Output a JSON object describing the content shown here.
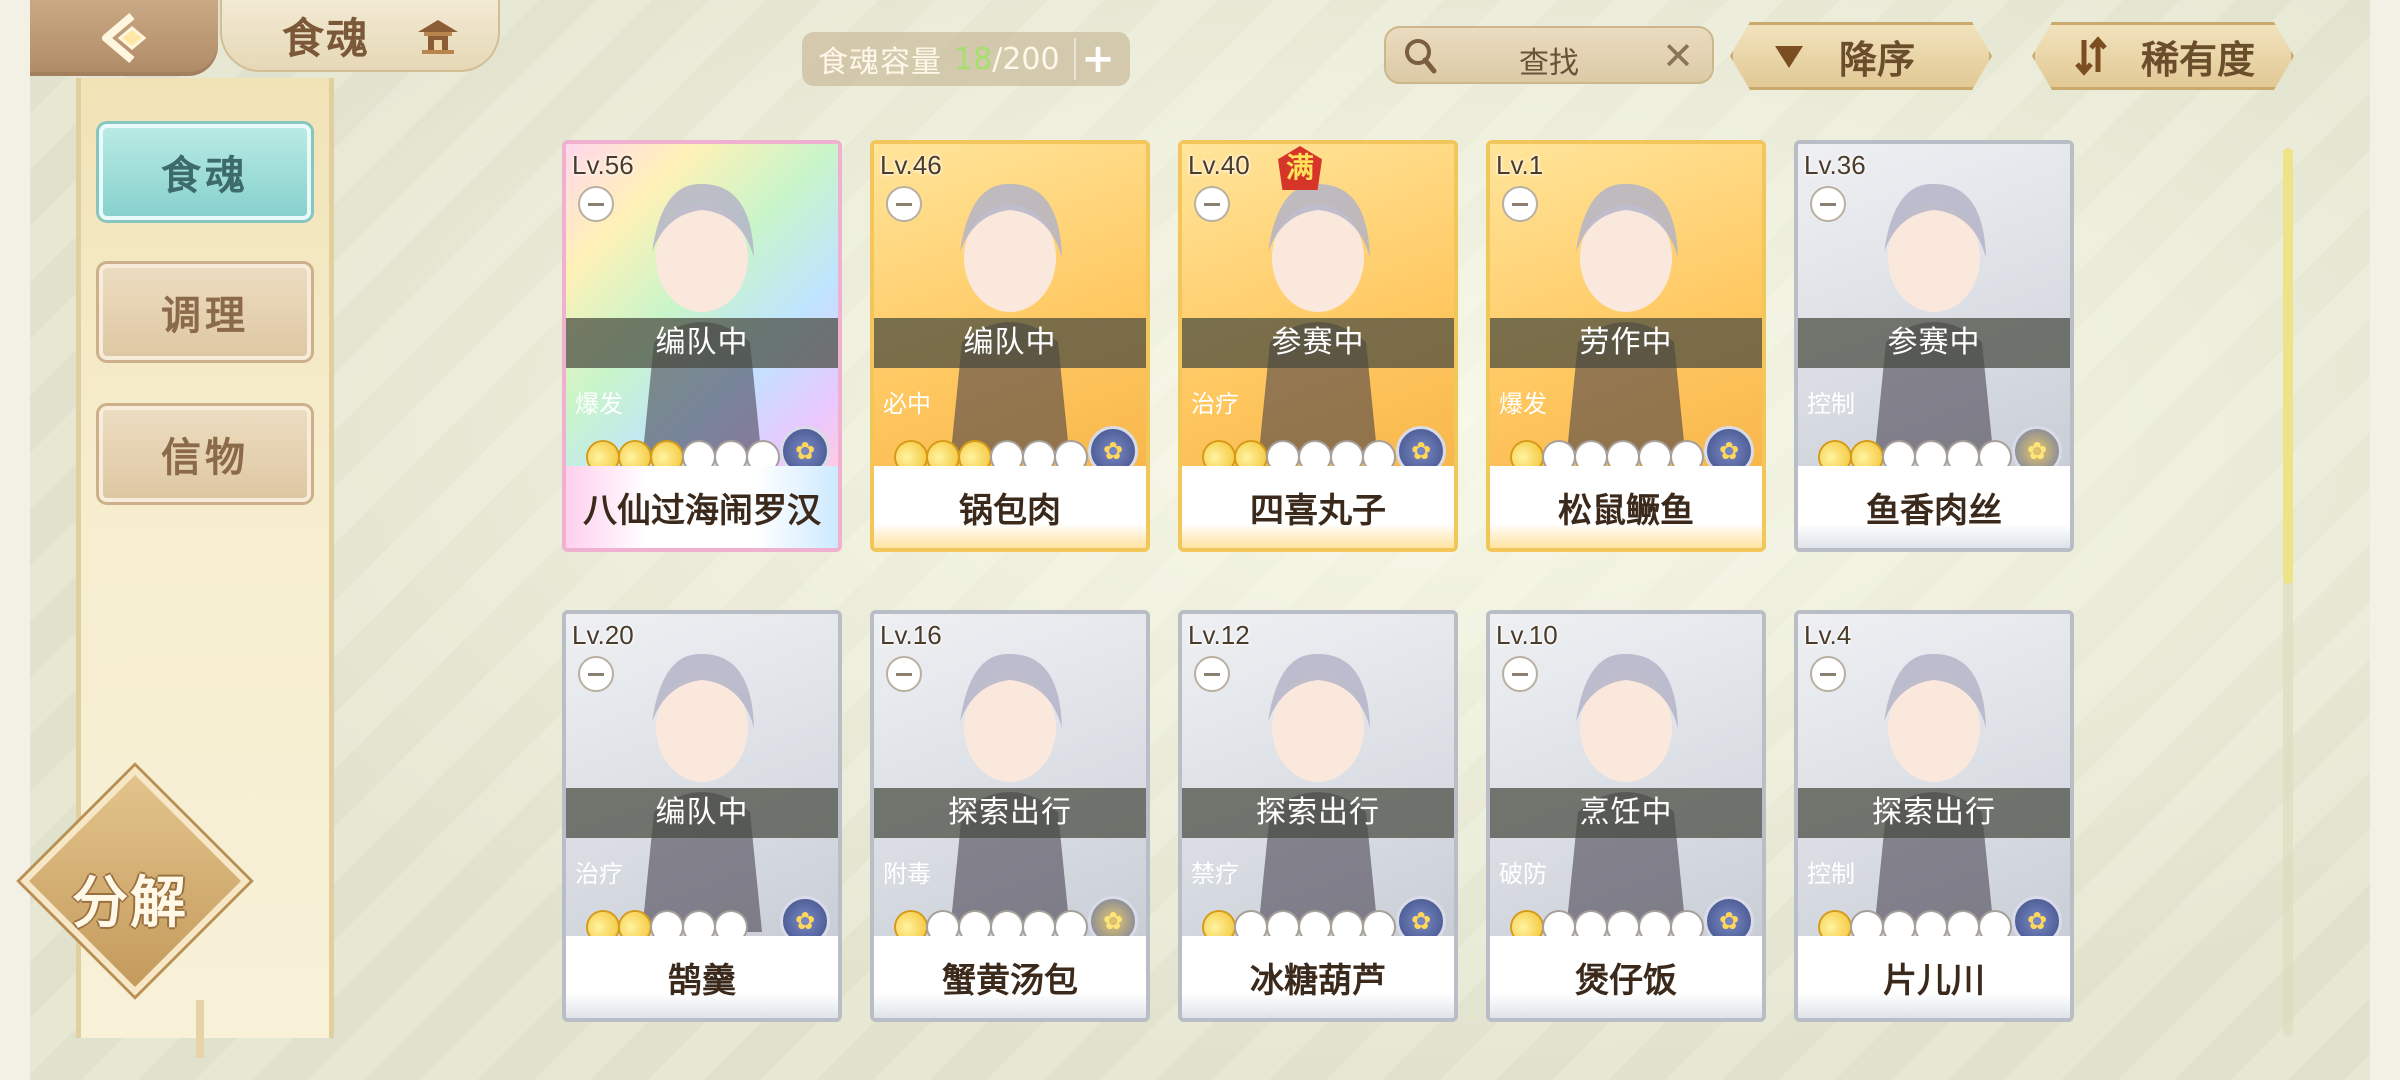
{
  "header": {
    "title": "食魂",
    "capacity_label": "食魂容量",
    "capacity_count": "18",
    "capacity_max": "/200",
    "capacity_add": "+",
    "search_text": "查找",
    "search_clear": "✕",
    "sort_order": "降序",
    "sort_by": "稀有度"
  },
  "sidebar": {
    "items": [
      {
        "label": "食魂",
        "active": true
      },
      {
        "label": "调理",
        "active": false
      },
      {
        "label": "信物",
        "active": false
      }
    ],
    "decompose": "分解"
  },
  "cards": [
    {
      "level": "Lv.56",
      "status": "编队中",
      "role": "爆发",
      "name": "八仙过海闹罗汉",
      "rarity": "rainbow",
      "stars_lit": 3,
      "stars_total": 6,
      "element": "blue",
      "full": false
    },
    {
      "level": "Lv.46",
      "status": "编队中",
      "role": "必中",
      "name": "锅包肉",
      "rarity": "gold",
      "stars_lit": 3,
      "stars_total": 6,
      "element": "blue",
      "full": false
    },
    {
      "level": "Lv.40",
      "status": "参赛中",
      "role": "治疗",
      "name": "四喜丸子",
      "rarity": "gold",
      "stars_lit": 2,
      "stars_total": 6,
      "element": "blue",
      "full": true,
      "full_label": "满"
    },
    {
      "level": "Lv.1",
      "status": "劳作中",
      "role": "爆发",
      "name": "松鼠鳜鱼",
      "rarity": "gold",
      "stars_lit": 1,
      "stars_total": 6,
      "element": "blue",
      "full": false
    },
    {
      "level": "Lv.36",
      "status": "参赛中",
      "role": "控制",
      "name": "鱼香肉丝",
      "rarity": "silver",
      "stars_lit": 2,
      "stars_total": 6,
      "element": "gold",
      "full": false
    },
    {
      "level": "Lv.20",
      "status": "编队中",
      "role": "治疗",
      "name": "鹄羹",
      "rarity": "silver",
      "stars_lit": 2,
      "stars_total": 5,
      "element": "blue",
      "full": false
    },
    {
      "level": "Lv.16",
      "status": "探索出行",
      "role": "附毒",
      "name": "蟹黄汤包",
      "rarity": "silver",
      "stars_lit": 1,
      "stars_total": 6,
      "element": "gold",
      "full": false
    },
    {
      "level": "Lv.12",
      "status": "探索出行",
      "role": "禁疗",
      "name": "冰糖葫芦",
      "rarity": "silver",
      "stars_lit": 1,
      "stars_total": 6,
      "element": "blue",
      "full": false
    },
    {
      "level": "Lv.10",
      "status": "烹饪中",
      "role": "破防",
      "name": "煲仔饭",
      "rarity": "silver",
      "stars_lit": 1,
      "stars_total": 6,
      "element": "blue",
      "full": false
    },
    {
      "level": "Lv.4",
      "status": "探索出行",
      "role": "控制",
      "name": "片儿川",
      "rarity": "silver",
      "stars_lit": 1,
      "stars_total": 6,
      "element": "blue",
      "full": false
    }
  ],
  "colors": {
    "capacity_count": "#a5e06c",
    "active_tab": "#87d1cd",
    "role_badge": "#b58b4c",
    "status_band": "#464a3e"
  }
}
